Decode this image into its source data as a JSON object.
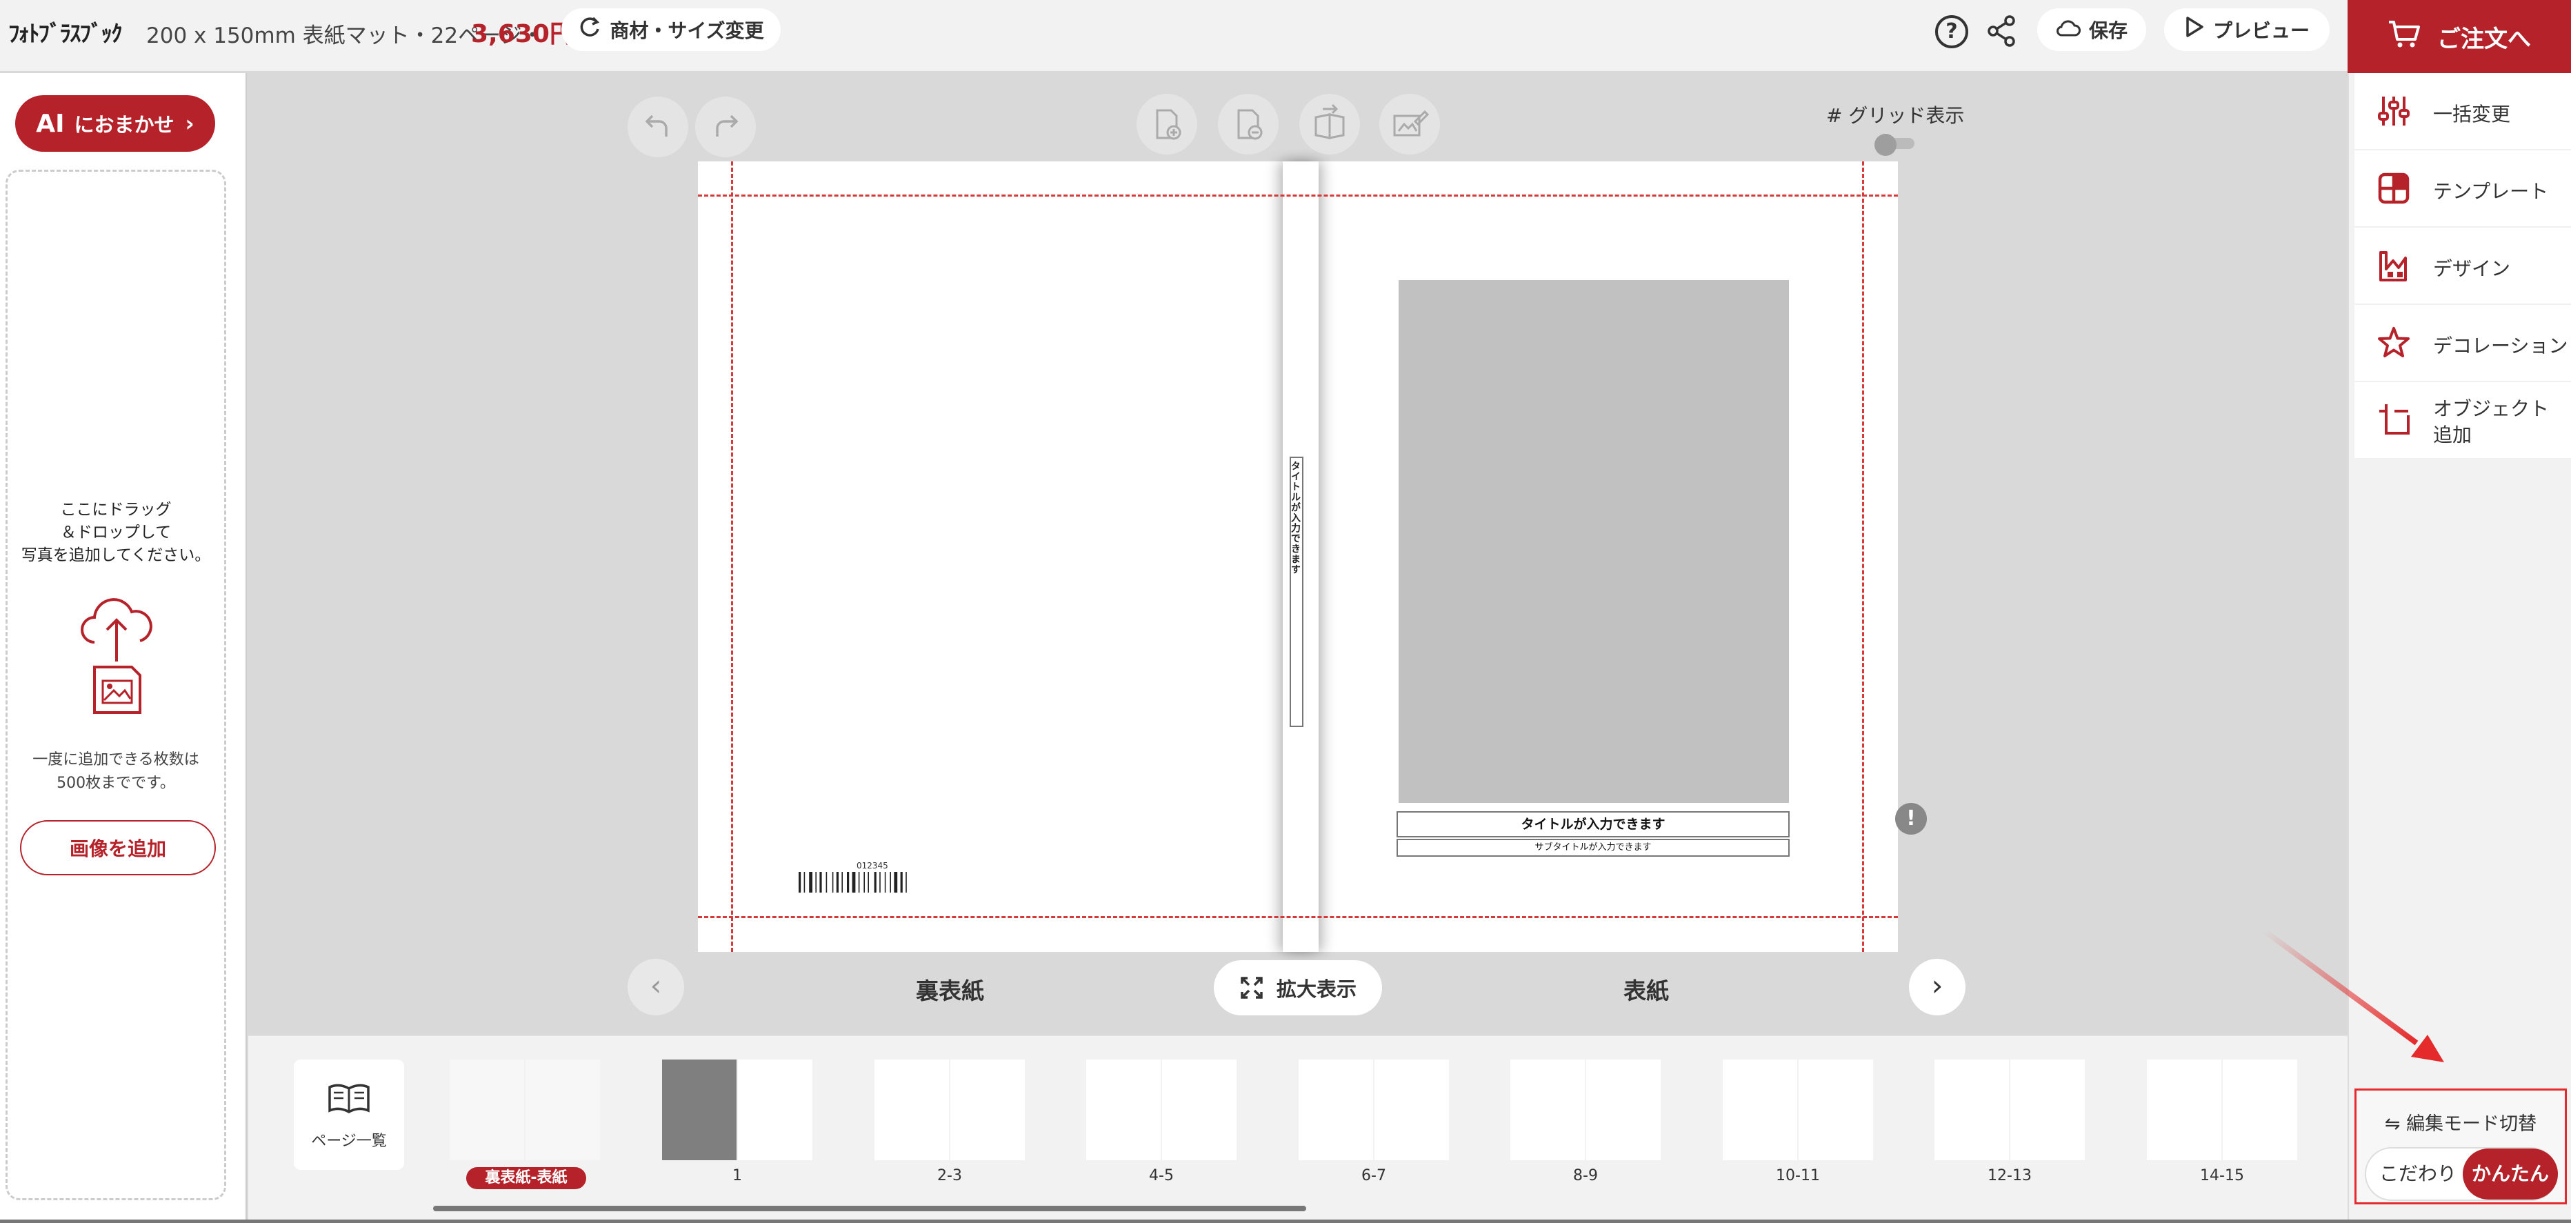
{
  "header": {
    "logo": "ﾌｫﾄﾌﾞﾗｽﾌﾞｯｸ",
    "product_info": "200 x 150mm 表紙マット・22ページ・",
    "price": "3,630円",
    "change_material_label": "商材・サイズ変更",
    "save_label": "保存",
    "preview_label": "プレビュー",
    "order_label": "ご注文へ"
  },
  "left_panel": {
    "ai_label": "にAIおまかせ",
    "ai_prefix": "AI",
    "ai_text": "におまかせ",
    "drop_text": "ここにドラッグ\n＆ドロップして\n写真を追加してください。",
    "limit_text": "一度に追加できる枚数は\n500枚までです。",
    "add_image_label": "画像を追加"
  },
  "editor": {
    "grid_label": "グリッド表示",
    "grid_enabled": false,
    "spine_title": "タイトルが入力できます",
    "barcode_number": "012345",
    "cover_title": "タイトルが入力できます",
    "cover_subtitle": "サブタイトルが入力できます",
    "warning_mark": "!",
    "back_cover_label": "裏表紙",
    "front_cover_label": "表紙",
    "zoom_label": "拡大表示"
  },
  "thumbnails": {
    "page_list_label": "ページ一覧",
    "items": [
      {
        "label": "裏表紙-表紙",
        "selected": true
      },
      {
        "label": "1"
      },
      {
        "label": "2-3"
      },
      {
        "label": "4-5"
      },
      {
        "label": "6-7"
      },
      {
        "label": "8-9"
      },
      {
        "label": "10-11"
      },
      {
        "label": "12-13"
      },
      {
        "label": "14-15"
      }
    ]
  },
  "right_panel": {
    "menu": [
      {
        "label": "一括変更",
        "icon": "sliders-icon"
      },
      {
        "label": "テンプレート",
        "icon": "template-icon"
      },
      {
        "label": "デザイン",
        "icon": "design-icon"
      },
      {
        "label": "デコレーション",
        "icon": "star-icon"
      },
      {
        "label": "オブジェクト\n追加",
        "icon": "add-object-icon"
      }
    ],
    "mode_label": "編集モード切替",
    "mode_options": [
      "こだわり",
      "かんたん"
    ],
    "mode_selected": "かんたん"
  },
  "colors": {
    "accent": "#b5222a",
    "bleed_line": "#d43a3a",
    "annotation": "#e42a2a"
  }
}
